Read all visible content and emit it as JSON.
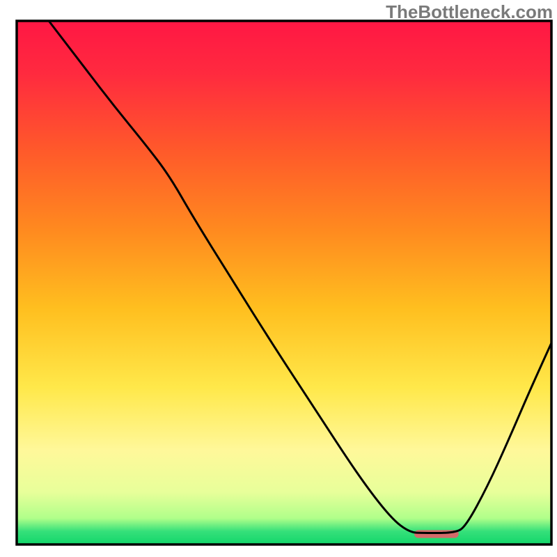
{
  "watermark": "TheBottleneck.com",
  "chart_data": {
    "type": "line",
    "title": "",
    "xlabel": "",
    "ylabel": "",
    "xlim": [
      0,
      100
    ],
    "ylim": [
      0,
      100
    ],
    "grid": false,
    "legend": false,
    "annotations": [],
    "gradient_stops": [
      {
        "offset": 0.0,
        "color": "#ff1744"
      },
      {
        "offset": 0.1,
        "color": "#ff2a3f"
      },
      {
        "offset": 0.25,
        "color": "#ff5a2a"
      },
      {
        "offset": 0.4,
        "color": "#ff8a1f"
      },
      {
        "offset": 0.55,
        "color": "#ffbf1f"
      },
      {
        "offset": 0.7,
        "color": "#ffe84a"
      },
      {
        "offset": 0.82,
        "color": "#fff89a"
      },
      {
        "offset": 0.9,
        "color": "#e8ff9a"
      },
      {
        "offset": 0.95,
        "color": "#b0ff8a"
      },
      {
        "offset": 0.975,
        "color": "#35e07a"
      },
      {
        "offset": 1.0,
        "color": "#12d66a"
      }
    ],
    "marker": {
      "x": 78.5,
      "y": 2.0,
      "width": 8.3,
      "height": 1.5,
      "color": "#d46a6a",
      "rx": 0.8
    },
    "series": [
      {
        "name": "curve",
        "color": "#000000",
        "stroke_width": 3,
        "points": [
          {
            "x": 6.0,
            "y": 100.0
          },
          {
            "x": 12.0,
            "y": 92.0
          },
          {
            "x": 18.0,
            "y": 84.0
          },
          {
            "x": 24.0,
            "y": 76.5
          },
          {
            "x": 28.5,
            "y": 70.5
          },
          {
            "x": 33.0,
            "y": 62.5
          },
          {
            "x": 40.0,
            "y": 51.0
          },
          {
            "x": 48.0,
            "y": 38.0
          },
          {
            "x": 56.0,
            "y": 25.5
          },
          {
            "x": 64.0,
            "y": 13.0
          },
          {
            "x": 70.0,
            "y": 5.0
          },
          {
            "x": 73.5,
            "y": 2.3
          },
          {
            "x": 76.0,
            "y": 2.2
          },
          {
            "x": 82.0,
            "y": 2.2
          },
          {
            "x": 84.0,
            "y": 3.5
          },
          {
            "x": 88.0,
            "y": 11.0
          },
          {
            "x": 92.0,
            "y": 20.0
          },
          {
            "x": 96.0,
            "y": 29.5
          },
          {
            "x": 100.0,
            "y": 38.5
          }
        ]
      }
    ]
  }
}
